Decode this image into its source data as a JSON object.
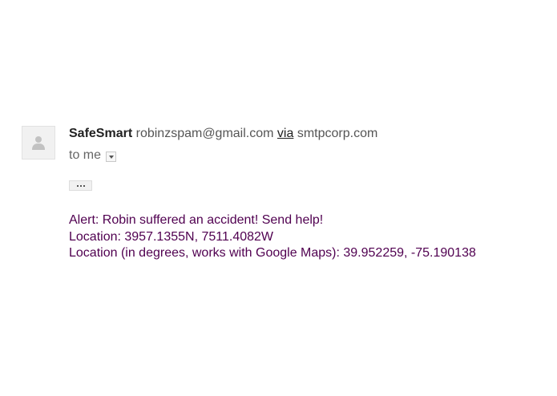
{
  "sender": {
    "name": "SafeSmart",
    "email": "robinzspam@gmail.com",
    "via_label": "via",
    "via_domain": "smtpcorp.com"
  },
  "recipient": {
    "label": "to me"
  },
  "icons": {
    "avatar": "person-silhouette-icon",
    "dropdown": "caret-down-icon",
    "show_trimmed": "ellipsis-icon"
  },
  "message": {
    "lines": [
      "Alert: Robin suffered an accident! Send help!",
      "Location: 3957.1355N, 7511.4082W",
      "Location (in degrees, works with Google Maps): 39.952259, -75.190138"
    ]
  },
  "colors": {
    "body_text": "#500050",
    "sender_name": "#222222",
    "secondary_text": "#555555"
  }
}
